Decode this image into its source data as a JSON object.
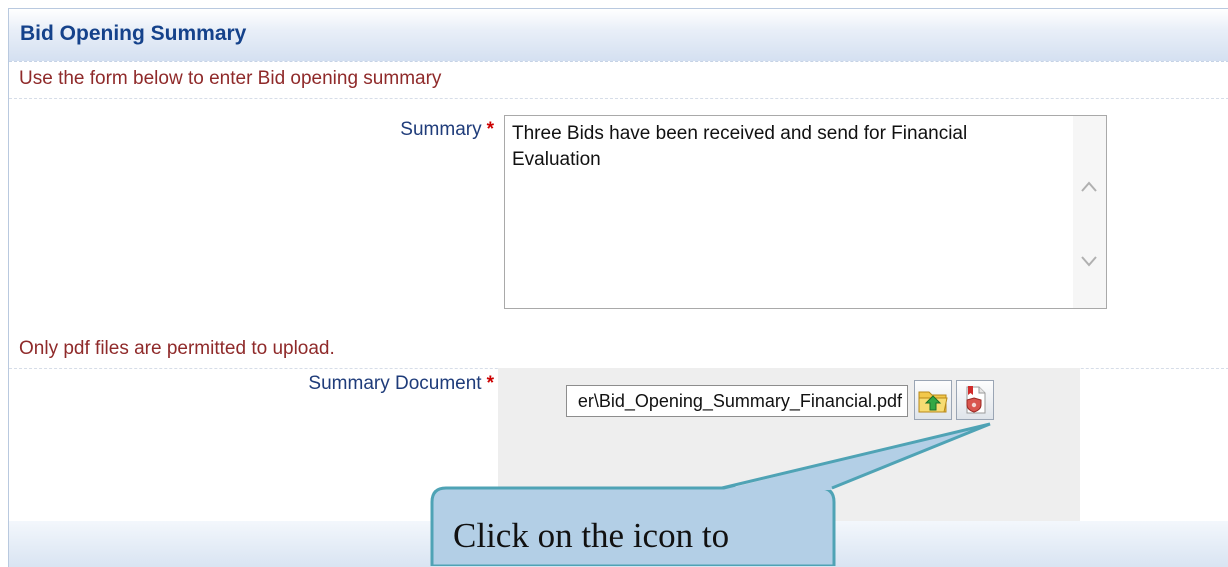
{
  "header": {
    "title": "Bid Opening Summary"
  },
  "form": {
    "instruction": "Use the form below to enter Bid opening summary",
    "summary_label": "Summary",
    "required_mark": "*",
    "summary_value_line1": "Three Bids have been received and send for Financial",
    "summary_value_line2": "Evaluation",
    "pdf_note": "Only pdf files are permitted to upload.",
    "document_label": "Summary Document",
    "document_file_value": "er\\Bid_Opening_Summary_Financial.pdf"
  },
  "icons": {
    "upload": "folder-upload-icon",
    "pdf": "pdf-secure-icon",
    "scroll_up": "chevron-up-icon",
    "scroll_down": "chevron-down-icon"
  },
  "callout": {
    "text": "Click on the icon to"
  },
  "colors": {
    "title": "#15428b",
    "note": "#8f2a2a",
    "label": "#1f3c7a",
    "required": "#cc0000",
    "callout_fill": "#b3cfe6",
    "callout_border": "#4fa3b5"
  }
}
